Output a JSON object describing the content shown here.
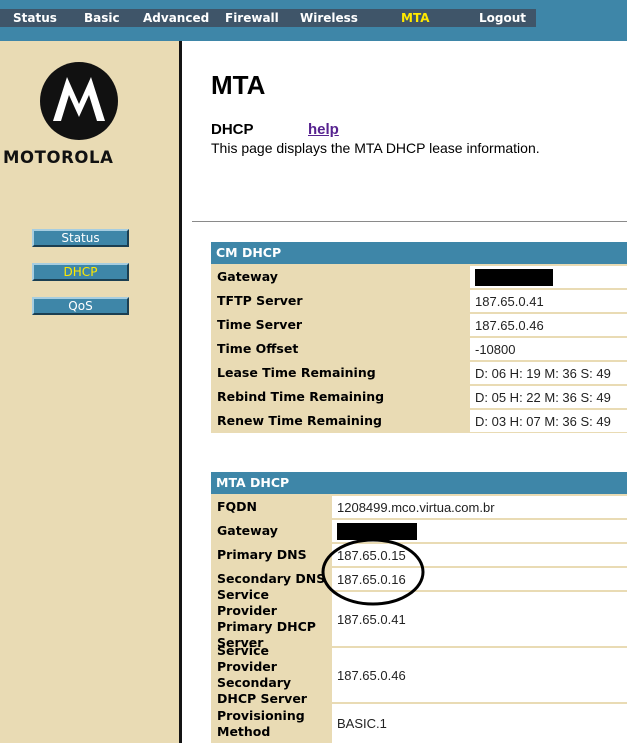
{
  "topnav": {
    "items": [
      {
        "label": "Status",
        "active": false
      },
      {
        "label": "Basic",
        "active": false
      },
      {
        "label": "Advanced",
        "active": false
      },
      {
        "label": "Firewall",
        "active": false
      },
      {
        "label": "Wireless",
        "active": false
      },
      {
        "label": "MTA",
        "active": true
      },
      {
        "label": "Logout",
        "active": false
      }
    ]
  },
  "sidebar": {
    "brand": "MOTOROLA",
    "logo_icon": "motorola-batwing-logo",
    "items": [
      {
        "label": "Status",
        "active": false
      },
      {
        "label": "DHCP",
        "active": true
      },
      {
        "label": "QoS",
        "active": false
      }
    ]
  },
  "main": {
    "title": "MTA",
    "section": "DHCP",
    "help": "help",
    "description": "This page displays the MTA DHCP lease information."
  },
  "cm_dhcp": {
    "header": "CM DHCP",
    "rows": [
      {
        "label": "Gateway",
        "value": "",
        "redacted": true
      },
      {
        "label": "TFTP Server",
        "value": "187.65.0.41"
      },
      {
        "label": "Time Server",
        "value": "187.65.0.46"
      },
      {
        "label": "Time Offset",
        "value": "-10800"
      },
      {
        "label": "Lease Time Remaining",
        "value": "D: 06 H: 19 M: 36 S: 49"
      },
      {
        "label": "Rebind Time Remaining",
        "value": "D: 05 H: 22 M: 36 S: 49"
      },
      {
        "label": "Renew Time Remaining",
        "value": "D: 03 H: 07 M: 36 S: 49"
      }
    ]
  },
  "mta_dhcp": {
    "header": "MTA DHCP",
    "rows": [
      {
        "label": "FQDN",
        "value": "1208499.mco.virtua.com.br"
      },
      {
        "label": "Gateway",
        "value": "",
        "redacted": true
      },
      {
        "label": "Primary DNS",
        "value": "187.65.0.15"
      },
      {
        "label": "Secondary DNS",
        "value": "187.65.0.16"
      },
      {
        "label": "Service Provider Primary DHCP Server",
        "value": "187.65.0.41"
      },
      {
        "label": "Service Provider Secondary DHCP Server",
        "value": "187.65.0.46"
      },
      {
        "label": "Provisioning Method",
        "value": "BASIC.1"
      }
    ]
  },
  "colors": {
    "nav_band": "#3e86a8",
    "nav_bar": "#3f5569",
    "sidebar": "#e9dbb4",
    "active_text": "#ffe900",
    "help_link": "#56228f",
    "annotation": "#000000"
  }
}
